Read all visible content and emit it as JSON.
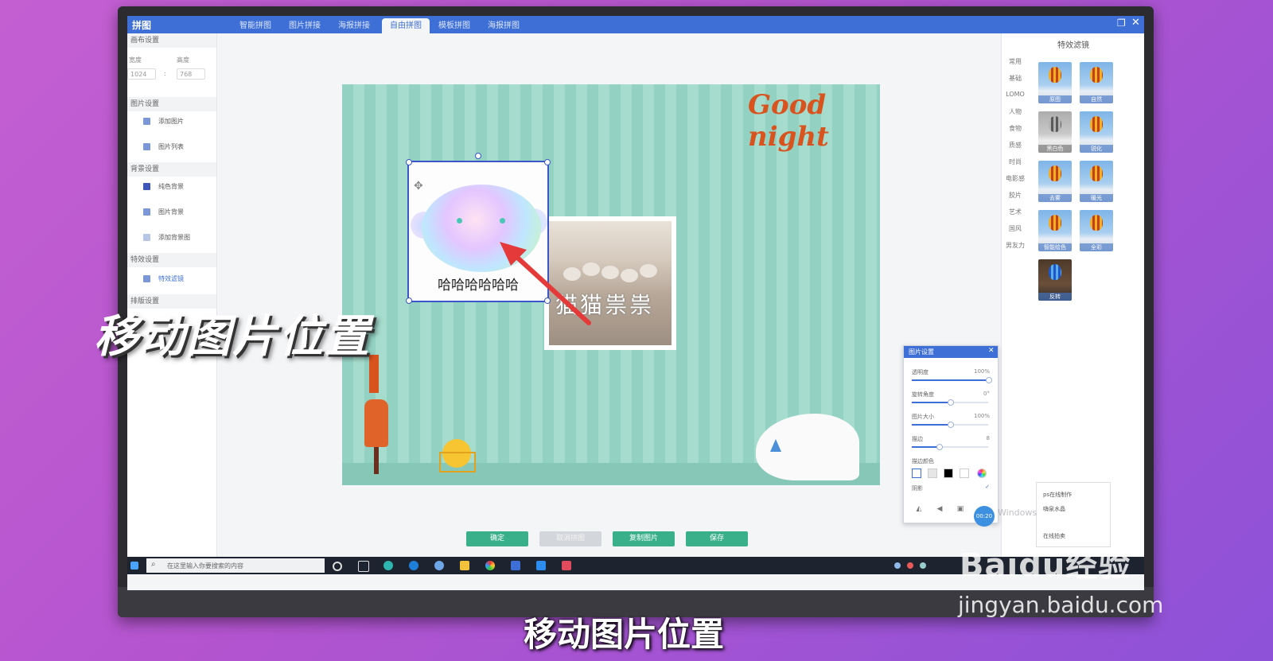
{
  "window": {
    "app_title": "拼图",
    "tabs": [
      "智能拼图",
      "图片拼接",
      "海报拼接",
      "自由拼图",
      "模板拼图",
      "海报拼图"
    ],
    "active_tab": 3,
    "restore_icon": "restore-icon",
    "close_icon": "close-icon"
  },
  "left_panel": {
    "canvas_section": "画布设置",
    "width_label": "宽度",
    "height_label": "高度",
    "width_value": "1024",
    "height_value": "768",
    "separator": ":",
    "image_section": "图片设置",
    "add_image": "添加图片",
    "image_list": "图片列表",
    "bg_section": "背景设置",
    "solid_bg": "纯色背景",
    "image_bg": "图片背景",
    "add_bg_image": "添加背景图",
    "effect_section": "特效设置",
    "effect_filter": "特效滤镜",
    "layout_section": "排版设置"
  },
  "canvas": {
    "goodnight_text": "Good night",
    "photo1_caption": "哈哈哈哈哈哈",
    "photo2_caption": "猫猫祟祟"
  },
  "filters": {
    "title": "特效滤镜",
    "categories": [
      "常用",
      "基础",
      "LOMO",
      "人物",
      "食物",
      "质感",
      "时尚",
      "电影感",
      "胶片",
      "艺术",
      "国风",
      "男友力"
    ],
    "thumbs": [
      "原图",
      "自然",
      "黑白色",
      "锐化",
      "去雾",
      "暖光",
      "智能绘色",
      "全彩",
      "反转"
    ]
  },
  "image_settings": {
    "title": "图片设置",
    "opacity_label": "透明度",
    "opacity_value": "100%",
    "opacity_level": 1.0,
    "rotate_label": "旋转角度",
    "rotate_value": "0°",
    "rotate_level": 0.5,
    "size_label": "图片大小",
    "size_value": "100%",
    "size_level": 0.5,
    "border_label": "描边",
    "border_value": "8",
    "border_level": 0.35,
    "border_color_label": "描边颜色",
    "shadow_label": "阴影",
    "swatch_colors": [
      "#ffffff",
      "#e6e6e6",
      "#000000",
      "#ffffff"
    ]
  },
  "buttons": {
    "confirm": "确定",
    "cancel_collage": "取消拼图",
    "copy_image": "复制图片",
    "save": "保存"
  },
  "notice": {
    "items": [
      "ps在线制作",
      "嗨泉水晶",
      "在线拍卖"
    ],
    "timer": "00:20",
    "watermark": "Windows"
  },
  "taskbar": {
    "search_placeholder": "在这里输入你要搜索的内容"
  },
  "overlay": {
    "title": "移动图片位置",
    "subtitle": "移动图片位置"
  },
  "branding": {
    "logo": "Baidu经验",
    "url": "jingyan.baidu.com"
  }
}
